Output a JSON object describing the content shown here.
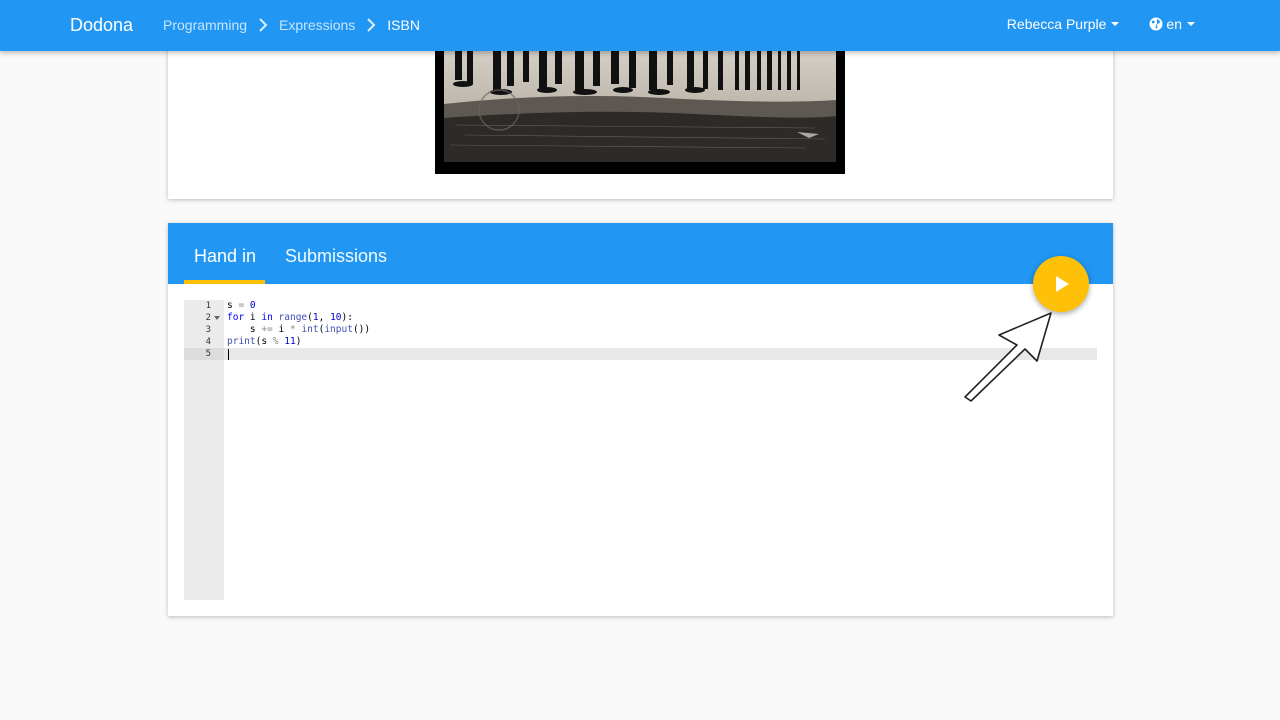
{
  "navbar": {
    "brand": "Dodona",
    "breadcrumbs": [
      "Programming",
      "Expressions",
      "ISBN"
    ],
    "user": "Rebecca Purple",
    "language": "en",
    "color": "#2196f3"
  },
  "tabs": {
    "hand_in": "Hand in",
    "submissions": "Submissions"
  },
  "editor": {
    "line_numbers": [
      "1",
      "2",
      "3",
      "4",
      "5"
    ],
    "lines": [
      "s = 0",
      "for i in range(1, 10):",
      "    s += i * int(input())",
      "print(s % 11)",
      ""
    ],
    "active_line": 5
  },
  "run_button": {
    "icon": "play-icon",
    "color": "#ffc107"
  },
  "annotation": {
    "icon": "arrow-pointer-icon"
  }
}
